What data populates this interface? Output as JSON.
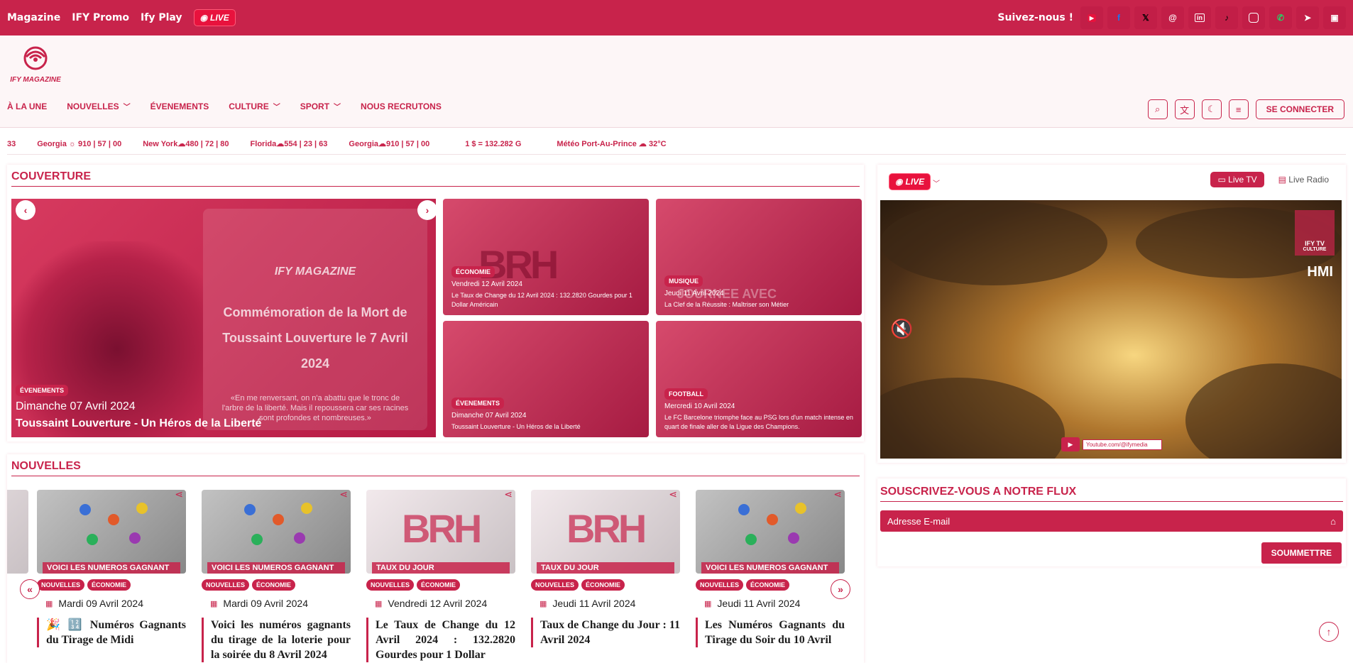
{
  "topbar": {
    "links": [
      "Magazine",
      "IFY Promo",
      "Ify Play"
    ],
    "live_label": "LIVE",
    "follow_label": "Suivez-nous !",
    "social": [
      "youtube-icon",
      "facebook-icon",
      "x-icon",
      "threads-icon",
      "linkedin-icon",
      "tiktok-icon",
      "instagram-icon",
      "whatsapp-icon",
      "telegram-icon",
      "twitch-icon"
    ],
    "color": "#c8234b"
  },
  "header": {
    "logo_text": "IFY MAGAZINE",
    "nav": [
      {
        "label": "À LA UNE",
        "dropdown": false
      },
      {
        "label": "NOUVELLES",
        "dropdown": true
      },
      {
        "label": "ÉVENEMENTS",
        "dropdown": false
      },
      {
        "label": "CULTURE",
        "dropdown": true
      },
      {
        "label": "SPORT",
        "dropdown": true
      },
      {
        "label": "NOUS RECRUTONS",
        "dropdown": false
      }
    ],
    "login_label": "SE CONNECTER"
  },
  "ticker": [
    "33",
    "Georgia ☼ 910 | 57 | 00",
    "New York☁480 | 72 | 80",
    "Florida☁554 | 23 | 63",
    "Georgia☁910 | 57 | 00",
    "1 $ = 132.282 G",
    "Météo Port-Au-Prince ☁ 32°C"
  ],
  "couverture": {
    "title": "COUVERTURE",
    "hero": {
      "brand": "IFY MAGAZINE",
      "headline": "Commémoration de la Mort de Toussaint Louverture le 7 Avril 2024",
      "quote": "«En me renversant, on n'a abattu que le tronc de l'arbre de la liberté. Mais il repoussera car ses racines sont profondes et nombreuses.»",
      "tag": "ÉVENEMENTS",
      "date": "Dimanche 07 Avril 2024",
      "title": "Toussaint Louverture - Un Héros de la Liberté"
    },
    "tiles": [
      {
        "tag": "ÉCONOMIE",
        "date": "Vendredi 12 Avril 2024",
        "title": "Le Taux de Change du 12 Avril 2024 : 132.2820 Gourdes pour 1 Dollar Américain",
        "big": "BRH"
      },
      {
        "tag": "MUSIQUE",
        "date": "Jeudi 11 Avril 2024",
        "title": "La Clef de la Réussite : Maîtriser son Métier",
        "big": "JOURNEE AVEC"
      },
      {
        "tag": "ÉVENEMENTS",
        "date": "Dimanche 07 Avril 2024",
        "title": "Toussaint Louverture - Un Héros de la Liberté",
        "big": ""
      },
      {
        "tag": "FOOTBALL",
        "date": "Mercredi 10 Avril 2024",
        "title": "Le FC Barcelone triomphe face au PSG lors d'un match intense en quart de finale aller de la Ligue des Champions.",
        "big": ""
      }
    ]
  },
  "live": {
    "label": "LIVE",
    "tabs": [
      {
        "label": "Live TV",
        "active": true
      },
      {
        "label": "Live Radio",
        "active": false
      }
    ],
    "video": {
      "channel": "IFY TV",
      "sub": "CULTURE",
      "hmi": "HMI",
      "url": "Youtube.com/@ifymedia"
    }
  },
  "subscribe": {
    "title": "SOUSCRIVEZ-VOUS A NOTRE FLUX",
    "placeholder": "Adresse E-mail",
    "submit": "SOUMMETTRE"
  },
  "nouvelles": {
    "title": "NOUVELLES",
    "cards": [
      {
        "caption": "VOICI LES NUMEROS GAGNANT",
        "tags": [
          "NOUVELLES",
          "ÉCONOMIE"
        ],
        "date": "Mardi 09 Avril 2024",
        "title": "🎉 🔢 Numéros Gagnants du Tirage de Midi",
        "kind": "balls"
      },
      {
        "caption": "VOICI LES NUMEROS GAGNANT",
        "tags": [
          "NOUVELLES",
          "ÉCONOMIE"
        ],
        "date": "Mardi 09 Avril 2024",
        "title": "Voici les numéros gagnants du tirage de la loterie pour la soirée du 8 Avril 2024",
        "kind": "balls"
      },
      {
        "caption": "TAUX DU JOUR",
        "tags": [
          "NOUVELLES",
          "ÉCONOMIE"
        ],
        "date": "Vendredi 12 Avril 2024",
        "title": "Le Taux de Change du 12 Avril 2024 : 132.2820 Gourdes pour 1 Dollar",
        "kind": "brh"
      },
      {
        "caption": "TAUX DU JOUR",
        "tags": [
          "NOUVELLES",
          "ÉCONOMIE"
        ],
        "date": "Jeudi 11 Avril 2024",
        "title": "Taux de Change du Jour : 11 Avril 2024",
        "kind": "brh"
      },
      {
        "caption": "VOICI LES NUMEROS GAGNANT",
        "tags": [
          "NOUVELLES",
          "ÉCONOMIE"
        ],
        "date": "Jeudi 11 Avril 2024",
        "title": "Les Numéros Gagnants du Tirage du Soir du 10 Avril",
        "kind": "balls"
      }
    ]
  }
}
